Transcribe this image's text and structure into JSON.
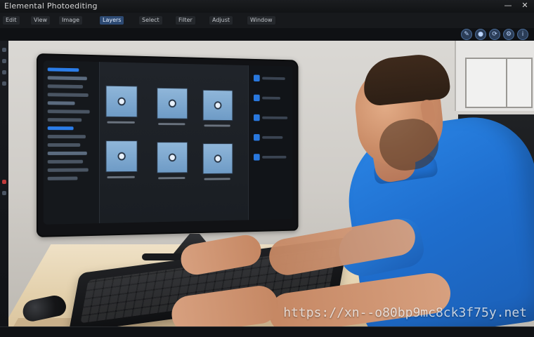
{
  "app": {
    "title": "Elemental  Photoediting"
  },
  "tabs": {
    "items": [
      "Edit",
      "View",
      "Image",
      "Layers",
      "Select",
      "Filter",
      "Adjust",
      "Window"
    ]
  },
  "watermark": {
    "text": "https://xn--o80bp9mc8ck3f75y.net"
  }
}
